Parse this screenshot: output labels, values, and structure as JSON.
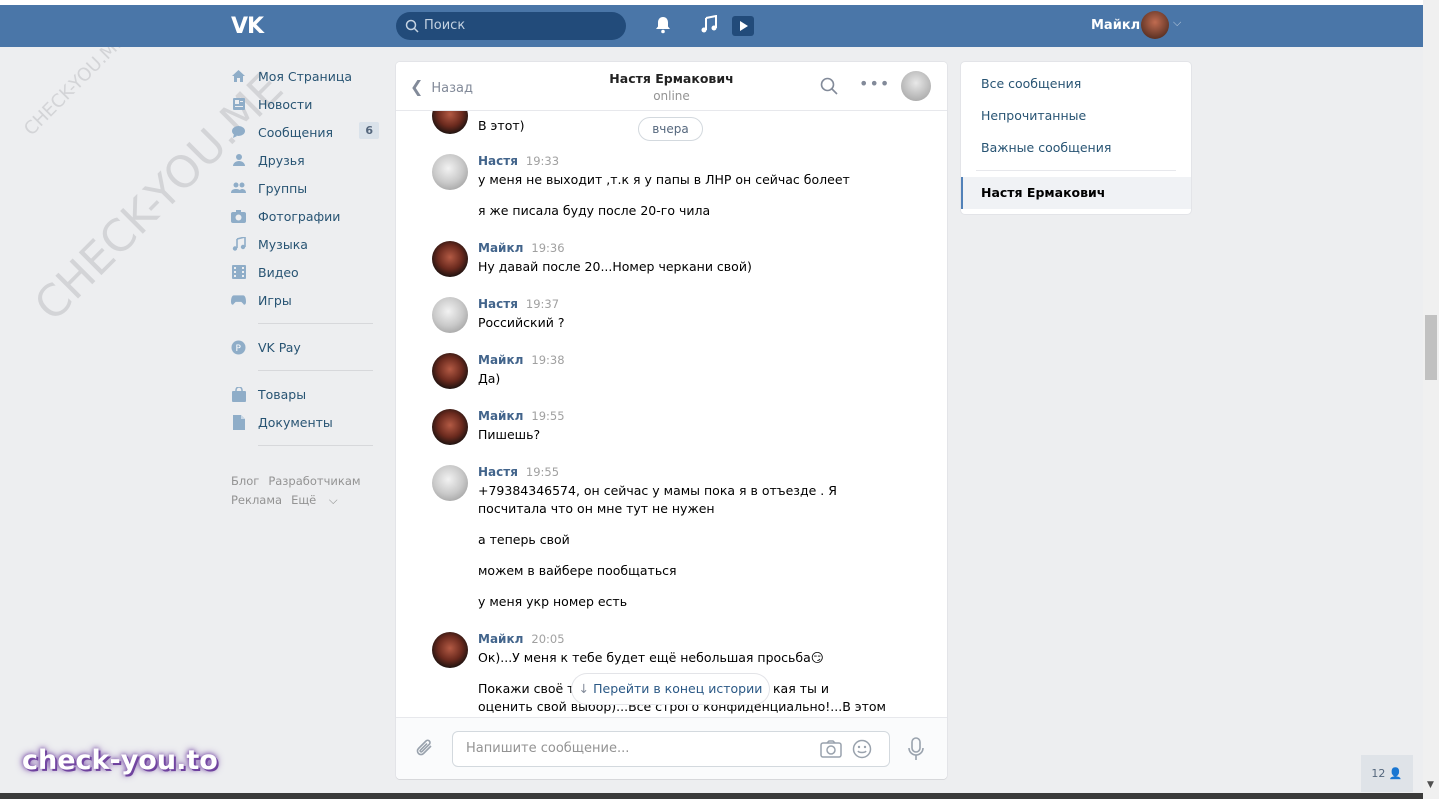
{
  "header": {
    "logo": "VK",
    "search_placeholder": "Поиск",
    "username": "Майкл",
    "icons": [
      "bell-icon",
      "music-icon",
      "video-icon",
      "search-icon"
    ]
  },
  "leftnav": {
    "items": [
      {
        "label": "Моя Страница",
        "icon": "home-icon"
      },
      {
        "label": "Новости",
        "icon": "news-icon"
      },
      {
        "label": "Сообщения",
        "icon": "chat-icon",
        "badge": "6"
      },
      {
        "label": "Друзья",
        "icon": "user-icon"
      },
      {
        "label": "Группы",
        "icon": "group-icon"
      },
      {
        "label": "Фотографии",
        "icon": "camera-icon"
      },
      {
        "label": "Музыка",
        "icon": "music-icon"
      },
      {
        "label": "Видео",
        "icon": "film-icon"
      },
      {
        "label": "Игры",
        "icon": "gamepad-icon"
      }
    ],
    "vkpay": "VK Pay",
    "goods": "Товары",
    "docs": "Документы",
    "footer": {
      "blog": "Блог",
      "dev": "Разработчикам",
      "ads": "Реклама",
      "more": "Ещё"
    }
  },
  "chat": {
    "back": "Назад",
    "peer_name": "Настя Ермакович",
    "peer_status": "online",
    "date_pill": "вчера",
    "jump_label": "Перейти в конец истории",
    "composer_placeholder": "Напишите сообщение...",
    "first_line": "В этот)",
    "messages": [
      {
        "author": "Настя",
        "time": "19:33",
        "lines": [
          "у меня не выходит ,т.к я у папы в ЛНР он сейчас болеет",
          "я же писала буду после 20-го чила"
        ]
      },
      {
        "author": "Майкл",
        "time": "19:36",
        "lines": [
          "Ну давай после 20...Номер черкани свой)"
        ]
      },
      {
        "author": "Настя",
        "time": "19:37",
        "lines": [
          "Российский ?"
        ]
      },
      {
        "author": "Майкл",
        "time": "19:38",
        "lines": [
          "Да)"
        ]
      },
      {
        "author": "Майкл",
        "time": "19:55",
        "lines": [
          "Пишешь?"
        ]
      },
      {
        "author": "Настя",
        "time": "19:55",
        "lines": [
          "+79384346574, он сейчас у мамы пока я в отъезде . Я",
          "посчитала что он мне тут не нужен",
          "а теперь свой",
          "можем в вайбере пообщаться",
          "у меня укр номер есть"
        ]
      },
      {
        "author": "Майкл",
        "time": "20:05",
        "lines": [
          "Ок)...У меня к тебе будет ещё небольшая просьба😏",
          "Покажи своё те",
          "кая ты и",
          "оценить свой выбор)...Все строго конфиденциально!...В этом"
        ]
      }
    ]
  },
  "rightnav": {
    "all": "Все сообщения",
    "unread": "Непрочитанные",
    "important": "Важные сообщения",
    "active": "Настя Ермакович"
  },
  "online_count": "12",
  "watermark": {
    "small": "CHECK-YOU.ME",
    "large": "CHECK-YOU.ME",
    "brand": "check-you.to"
  },
  "colors": {
    "header": "#4a76a8",
    "link": "#285473",
    "author": "#42648b",
    "bg": "#edeef0"
  }
}
